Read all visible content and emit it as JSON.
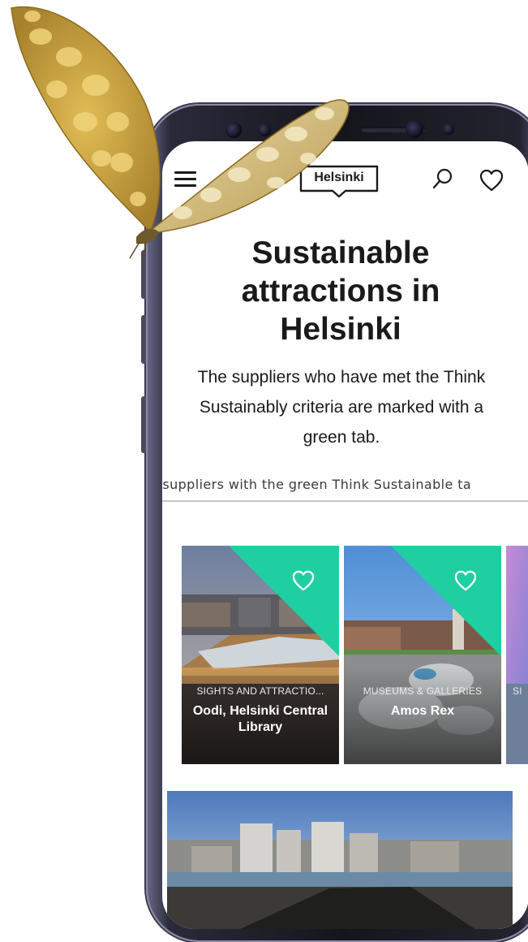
{
  "header": {
    "logo": "Helsinki",
    "menu_icon": "hamburger-menu-icon",
    "search_icon": "search-icon",
    "favorites_icon": "heart-icon"
  },
  "hero": {
    "title": "Sustainable attractions in Helsinki",
    "description": "The suppliers who have met the Think Sustainably criteria are marked with a green tab."
  },
  "filter_strip": {
    "text": "l suppliers with the green Think Sustainable ta"
  },
  "cards": [
    {
      "category": "SIGHTS AND ATTRACTIO...",
      "name": "Oodi, Helsinki Central Library",
      "badge_color": "#1fcfa2"
    },
    {
      "category": "MUSEUMS & GALLERIES",
      "name": "Amos Rex",
      "badge_color": "#1fcfa2"
    },
    {
      "category": "SI",
      "name": ""
    }
  ],
  "colors": {
    "accent_green": "#1fcfa2",
    "text": "#1a1a1a",
    "phone_frame": "#15151c"
  }
}
